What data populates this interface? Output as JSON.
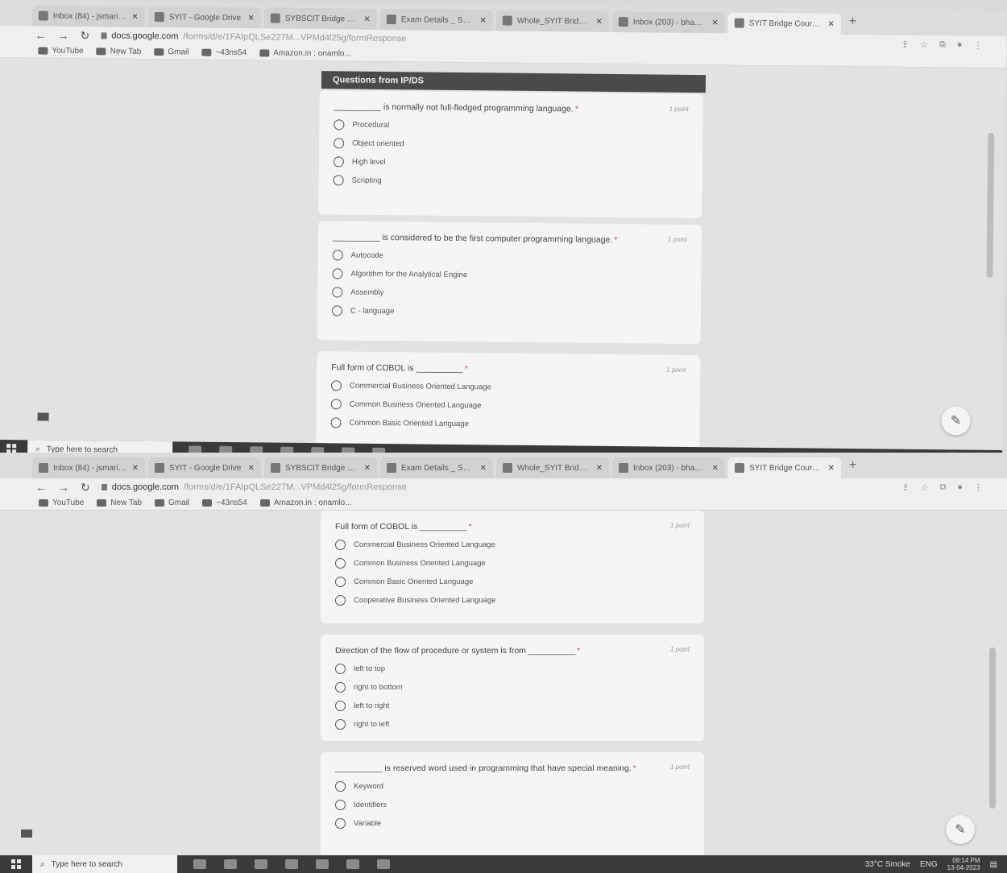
{
  "browser": {
    "tabs": [
      {
        "label": "Inbox (84) - jsmarinden",
        "icon": "gmail-icon",
        "active": false
      },
      {
        "label": "SYIT - Google Drive",
        "icon": "drive-icon",
        "active": false
      },
      {
        "label": "SYBSCIT Bridge course",
        "icon": "forms-icon",
        "active": false
      },
      {
        "label": "Exam Details _ SYIT",
        "icon": "forms-icon",
        "active": false
      },
      {
        "label": "Whole_SYIT Bridge Co",
        "icon": "forms-icon",
        "active": false
      },
      {
        "label": "Inbox (203) - bhagyas",
        "icon": "gmail-icon",
        "active": false
      },
      {
        "label": "SYIT Bridge Course Ex",
        "icon": "forms-icon",
        "active": true
      }
    ],
    "url_domain": "docs.google.com",
    "url_path": "/forms/d/e/1FAIpQLSe227M...VPMd4l25g/formResponse",
    "bookmarks": [
      {
        "label": "YouTube",
        "icon": "youtube-icon"
      },
      {
        "label": "New Tab",
        "icon": "chrome-icon"
      },
      {
        "label": "Gmail",
        "icon": "google-icon"
      },
      {
        "label": "~43ns54",
        "icon": "bookmark-icon"
      },
      {
        "label": "Amazon.in : onamlo...",
        "icon": "amazon-icon"
      }
    ]
  },
  "section_title": "Questions from IP/DS",
  "screen1_questions": [
    {
      "text": "__________ is normally not full-fledged programming language.",
      "points": "1 point",
      "options": [
        "Procedural",
        "Object oriented",
        "High level",
        "Scripting"
      ]
    },
    {
      "text": "__________ is considered to be the first computer programming language.",
      "points": "1 point",
      "options": [
        "Autocode",
        "Algorithm for the Analytical Engine",
        "Assembly",
        "C - language"
      ]
    },
    {
      "text": "Full form of COBOL is __________",
      "points": "1 point",
      "options": [
        "Commercial Business Oriented Language",
        "Common Business Oriented Language",
        "Common Basic Oriented Language"
      ]
    }
  ],
  "screen2_questions": [
    {
      "text": "Full form of COBOL is __________",
      "points": "1 point",
      "options": [
        "Commercial Business Oriented Language",
        "Common Business Oriented Language",
        "Common Basic Oriented Language",
        "Cooperative Business Oriented Language"
      ]
    },
    {
      "text": "Direction of the flow of procedure or system is from __________",
      "points": "1 point",
      "options": [
        "left to top",
        "right to bottom",
        "left to right",
        "right to left"
      ]
    },
    {
      "text": "__________ is reserved word used in programming that have special meaning.",
      "points": "1 point",
      "options": [
        "Keyword",
        "Identifiers",
        "Variable"
      ]
    }
  ],
  "taskbar": {
    "search_placeholder": "Type here to search",
    "weather": "33°C Smoke",
    "lang": "ENG",
    "time": "08:14 PM",
    "date": "13-04-2023"
  }
}
